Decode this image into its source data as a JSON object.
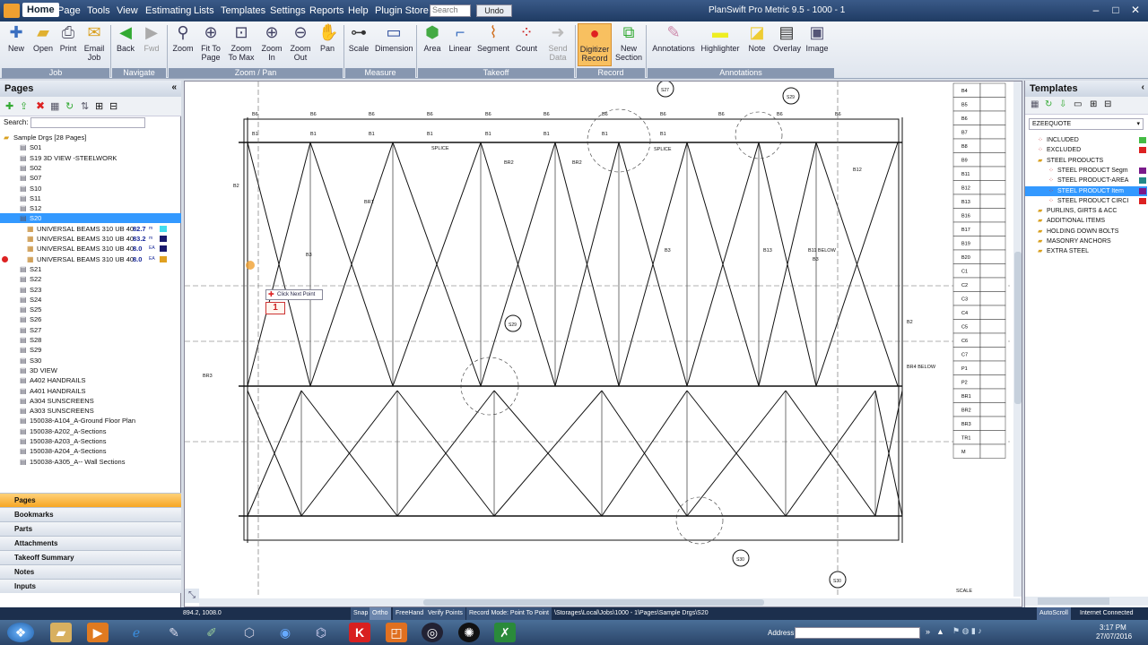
{
  "menubar": {
    "items": [
      "Home",
      "Page",
      "Tools",
      "View",
      "Estimating",
      "Lists",
      "Templates",
      "Settings",
      "Reports",
      "Help",
      "Plugin Store"
    ],
    "search_placeholder": "Search",
    "undo": "Undo",
    "title": "PlanSwift Pro Metric 9.5 - 1000 - 1"
  },
  "ribbon": {
    "buttons": [
      "New",
      "Open",
      "Print",
      "Email\nJob",
      "Back",
      "Fwd",
      "Zoom",
      "Fit To\nPage",
      "Zoom\nTo Max",
      "Zoom\nIn",
      "Zoom\nOut",
      "Pan",
      "Scale",
      "Dimension",
      "Area",
      "Linear",
      "Segment",
      "Count",
      "Send\nData",
      "Digitizer\nRecord",
      "New\nSection",
      "Annotations",
      "Highlighter",
      "Note",
      "Overlay",
      "Image"
    ],
    "groups": [
      "Job",
      "Navigate",
      "Zoom / Pan",
      "Measure",
      "Takeoff",
      "Record",
      "Annotations"
    ]
  },
  "left": {
    "title": "Pages",
    "search_label": "Search:",
    "tree": [
      {
        "text": "Sample Drgs [28 Pages]",
        "level": 0
      },
      {
        "text": "S01",
        "level": 1
      },
      {
        "text": "S19 3D VIEW -STEELWORK",
        "level": 1
      },
      {
        "text": "S02",
        "level": 1
      },
      {
        "text": "S07",
        "level": 1
      },
      {
        "text": "S10",
        "level": 1
      },
      {
        "text": "S11",
        "level": 1
      },
      {
        "text": "S12",
        "level": 1
      },
      {
        "text": "S20",
        "level": 1,
        "sel": true
      },
      {
        "text": "UNIVERSAL BEAMS 310 UB 40",
        "level": 2,
        "val": "82.7",
        "unit": "m",
        "color": "#44ddee"
      },
      {
        "text": "UNIVERSAL BEAMS 310 UB 40",
        "level": 2,
        "val": "83.2",
        "unit": "m",
        "color": "#1a1a6e"
      },
      {
        "text": "UNIVERSAL BEAMS 310 UB 40",
        "level": 2,
        "val": "8.0",
        "unit": "EA",
        "color": "#1a1a6e"
      },
      {
        "text": "UNIVERSAL BEAMS 310 UB 40",
        "level": 2,
        "val": "8.0",
        "unit": "EA",
        "color": "#e0a020"
      },
      {
        "text": "S21",
        "level": 1
      },
      {
        "text": "S22",
        "level": 1
      },
      {
        "text": "S23",
        "level": 1
      },
      {
        "text": "S24",
        "level": 1
      },
      {
        "text": "S25",
        "level": 1
      },
      {
        "text": "S26",
        "level": 1
      },
      {
        "text": "S27",
        "level": 1
      },
      {
        "text": "S28",
        "level": 1
      },
      {
        "text": "S29",
        "level": 1
      },
      {
        "text": "S30",
        "level": 1
      },
      {
        "text": "3D VIEW",
        "level": 1
      },
      {
        "text": "A402 HANDRAILS",
        "level": 1
      },
      {
        "text": "A401 HANDRAILS",
        "level": 1
      },
      {
        "text": "A304 SUNSCREENS",
        "level": 1
      },
      {
        "text": "A303 SUNSCREENS",
        "level": 1
      },
      {
        "text": "150038-A104_A-Ground Floor Plan",
        "level": 1
      },
      {
        "text": "150038-A202_A-Sections",
        "level": 1
      },
      {
        "text": "150038-A203_A-Sections",
        "level": 1
      },
      {
        "text": "150038-A204_A-Sections",
        "level": 1
      },
      {
        "text": "150038-A305_A-- Wall Sections",
        "level": 1
      }
    ],
    "nav": [
      "Pages",
      "Bookmarks",
      "Parts",
      "Attachments",
      "Takeoff Summary",
      "Notes",
      "Inputs"
    ]
  },
  "canvas": {
    "tooltip": "Click Next Point",
    "point_number": "1",
    "schedule": [
      "B4",
      "B5",
      "B6",
      "B7",
      "B8",
      "B9",
      "B11",
      "B12",
      "B13",
      "B16",
      "B17",
      "B19",
      "B20",
      "C1",
      "C2",
      "C3",
      "C4",
      "C5",
      "C6",
      "C7",
      "P1",
      "P2",
      "BR1",
      "BR2",
      "BR3",
      "TR1",
      "M"
    ],
    "labels_top": [
      "B6",
      "B6",
      "B6",
      "B6",
      "B6",
      "B6",
      "B6",
      "B6",
      "B6",
      "B6",
      "B6",
      "B1",
      "B1",
      "B1",
      "B1",
      "B1",
      "B1",
      "B1",
      "B1"
    ],
    "callouts": [
      "S27",
      "S29",
      "S29",
      "S30",
      "S30"
    ],
    "misc": [
      "SPLICE",
      "SPLICE",
      "BR1",
      "BR2",
      "BR2",
      "B2",
      "B3",
      "B12",
      "B3",
      "B11 BELOW",
      "B13",
      "B3",
      "B2",
      "BR3",
      "BR4 BELOW",
      "SCALE"
    ]
  },
  "right": {
    "title": "Templates",
    "dropdown": "EZEEQUOTE",
    "tree": [
      {
        "text": "INCLUDED",
        "level": 1,
        "color": "#44bb44"
      },
      {
        "text": "EXCLUDED",
        "level": 1,
        "color": "#dd2222"
      },
      {
        "text": "STEEL PRODUCTS",
        "level": 1
      },
      {
        "text": "STEEL PRODUCT Segm",
        "level": 2,
        "color": "#7a1a8a"
      },
      {
        "text": "STEEL PRODUCT-AREA",
        "level": 2,
        "color": "#228888"
      },
      {
        "text": "STEEL PRODUCT Item",
        "level": 2,
        "color": "#7a1a8a",
        "sel": true
      },
      {
        "text": "STEEL PRODUCT CIRCI",
        "level": 2,
        "color": "#dd2222"
      },
      {
        "text": "PURLINS, GIRTS & ACC",
        "level": 1
      },
      {
        "text": "ADDITIONAL ITEMS",
        "level": 1
      },
      {
        "text": "HOLDING DOWN BOLTS",
        "level": 1
      },
      {
        "text": "MASONRY ANCHORS",
        "level": 1
      },
      {
        "text": "EXTRA STEEL",
        "level": 1
      }
    ]
  },
  "status": {
    "coords": "894.2, 1008.0",
    "items": [
      "Snap",
      "Ortho",
      "FreeHand",
      "Verify Points",
      "Record Mode: Point To Point",
      "\\Storages\\Local\\Jobs\\1000 - 1\\Pages\\Sample Drgs\\S20"
    ],
    "autoscroll": "AutoScroll",
    "connection": "Internet Connected"
  },
  "taskbar": {
    "address_label": "Address",
    "time": "3:17 PM",
    "date": "27/07/2016"
  }
}
